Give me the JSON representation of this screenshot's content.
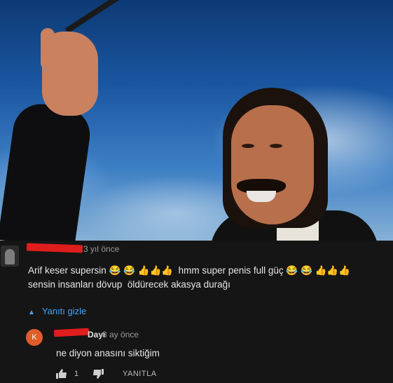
{
  "comment": {
    "time": "3 yıl önce",
    "line1": "Arif keser supersin 😂 😂 👍👍👍  hmm super penis full güç 😂 😂 👍👍👍",
    "line2": "sensin insanları dövup  öldürecek akasya durağı"
  },
  "hide_replies_label": "Yanıtı gizle",
  "reply": {
    "avatar_letter": "K",
    "name_fragment": "Dayı",
    "time": "8 ay önce",
    "text": "ne diyon anasını siktiğim",
    "like_count": "1",
    "reply_label": "YANITLA"
  },
  "colors": {
    "link": "#3ea6ff",
    "avatar_k": "#e05d2a",
    "redaction": "#e01d1d"
  },
  "icons": [
    "thumbs-up-icon",
    "thumbs-down-icon",
    "caret-up-icon"
  ]
}
